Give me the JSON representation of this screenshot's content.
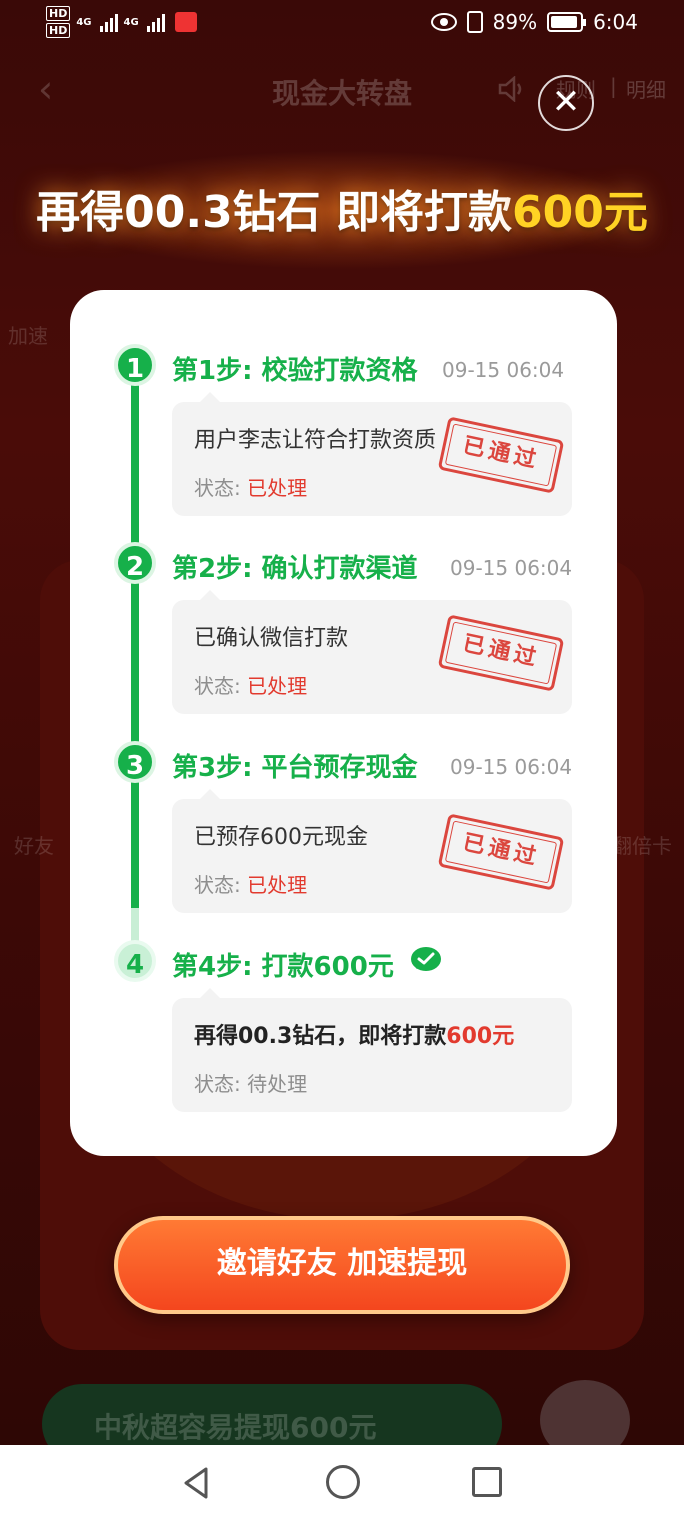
{
  "status_bar": {
    "hd1": "HD",
    "hd2": "HD",
    "net1": "4G",
    "net2": "4G",
    "battery_percent": "89%",
    "time": "6:04"
  },
  "background": {
    "page_title": "现金大转盘",
    "rules_link": "规则",
    "separator": "|",
    "detail_link": "明细",
    "side_label_left": "加速",
    "side_label_left2": "好友",
    "side_label_right": "翻倍卡",
    "bottom_pill": "中秋超容易提现600元"
  },
  "headline": {
    "prefix": "再得00.3钻石 即将打款",
    "amount": "600元"
  },
  "modal": {
    "steps": [
      {
        "num": "1",
        "title": "第1步: 校验打款资格",
        "time": "09-15 06:04",
        "line1": "用户李志让符合打款资质",
        "status_label": "状态:",
        "status_value": "已处理",
        "stamp": "已通过"
      },
      {
        "num": "2",
        "title": "第2步: 确认打款渠道",
        "time": "09-15 06:04",
        "line1": "已确认微信打款",
        "status_label": "状态:",
        "status_value": "已处理",
        "stamp": "已通过"
      },
      {
        "num": "3",
        "title": "第3步: 平台预存现金",
        "time": "09-15 06:04",
        "line1": "已预存600元现金",
        "status_label": "状态:",
        "status_value": "已处理",
        "stamp": "已通过"
      },
      {
        "num": "4",
        "title": "第4步: 打款600元",
        "line1_prefix": "再得00.3钻石，即将打款",
        "line1_amount": "600元",
        "status_label": "状态:",
        "status_value": "待处理"
      }
    ]
  },
  "cta": {
    "label": "邀请好友 加速提现"
  },
  "icons": {
    "close": "close-icon",
    "wechat": "wechat-icon",
    "speaker": "speaker-icon"
  },
  "colors": {
    "green": "#16b04a",
    "red": "#e23a2e",
    "gold": "#ffd324",
    "cta": "#f4461e"
  }
}
